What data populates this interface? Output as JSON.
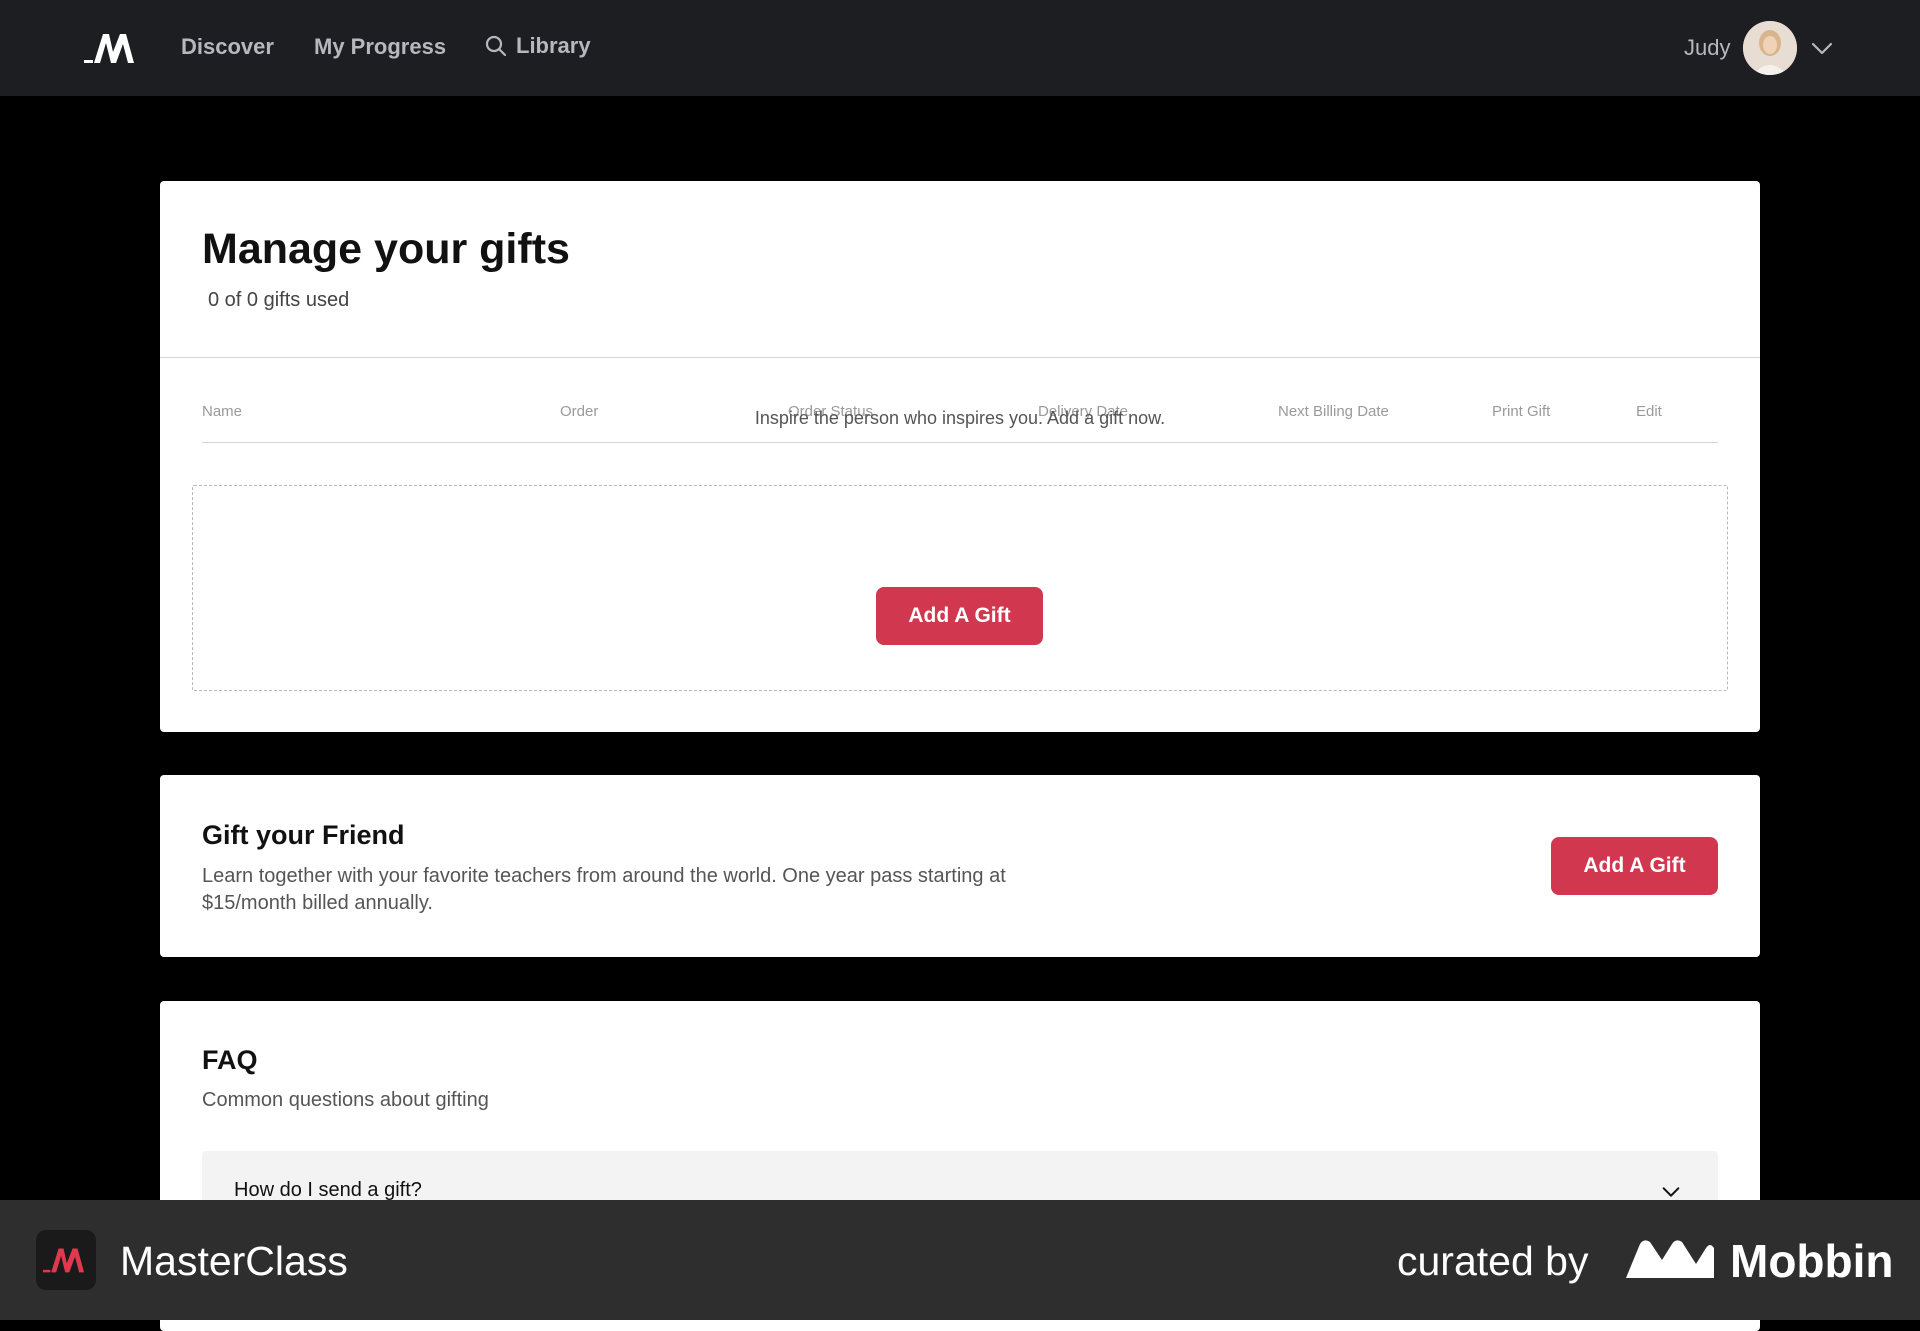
{
  "nav": {
    "links": {
      "discover": "Discover",
      "progress": "My Progress",
      "library": "Library"
    },
    "user_name": "Judy"
  },
  "manage": {
    "title": "Manage your gifts",
    "subtitle": "0 of 0 gifts used",
    "columns": [
      "Name",
      "Order",
      "Order Status",
      "Delivery Date",
      "Next Billing Date",
      "Print Gift",
      "Edit"
    ],
    "empty_message": "Inspire the person who inspires you. Add a gift now.",
    "add_button": "Add A Gift"
  },
  "gift_friend": {
    "title": "Gift your Friend",
    "description": "Learn together with your favorite teachers from around the world. One year pass starting at $15/month billed annually.",
    "add_button": "Add A Gift"
  },
  "faq": {
    "title": "FAQ",
    "subtitle": "Common questions about gifting",
    "items": [
      {
        "question": "How do I send a gift?"
      }
    ]
  },
  "brand": {
    "app_name": "MasterClass",
    "curated_label": "curated by",
    "curator_name": "Mobbin"
  },
  "colors": {
    "accent": "#d1384f",
    "nav_bg": "#1d1e21",
    "page_bg": "#000000",
    "brandbar_bg": "#2e2e2f"
  },
  "icons": {
    "library": "search-icon",
    "user_menu": "chevron-down-icon",
    "faq_toggle": "chevron-down-icon"
  }
}
